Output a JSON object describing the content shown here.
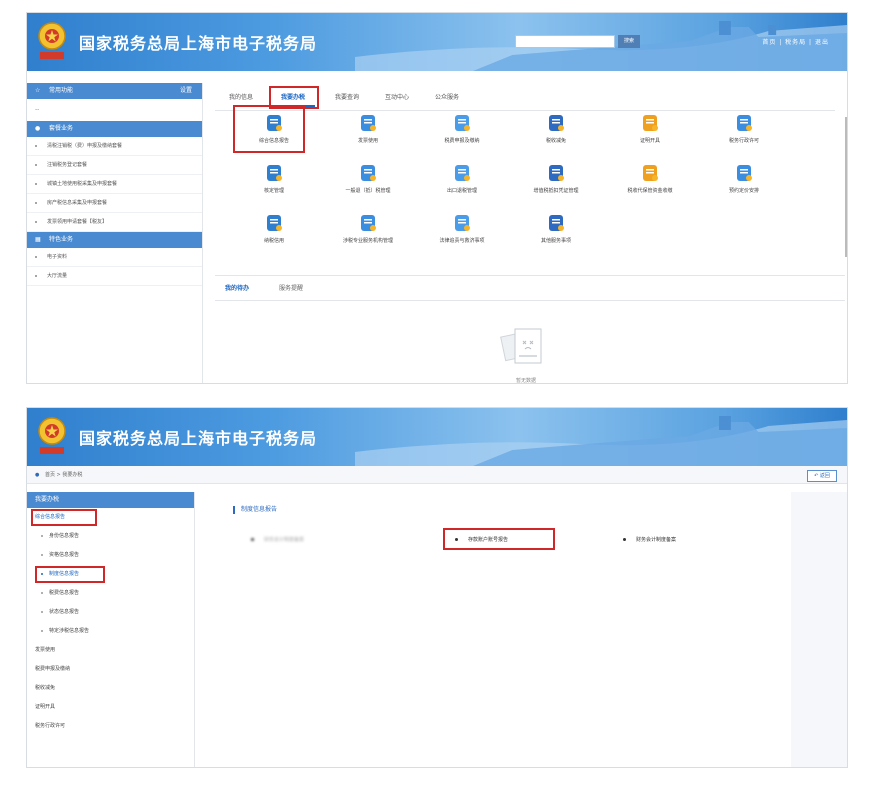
{
  "banner": {
    "title": "国家税务总局上海市电子税务局",
    "search_button": "搜索",
    "top_links": "首页 | 税务局 | 退出"
  },
  "panel1": {
    "sidebar": {
      "section1": {
        "label": "常用功能",
        "right": "设置"
      },
      "dash": "--",
      "section2": {
        "label": "套餐业务"
      },
      "items": [
        "清税注销税（费）申报及缴纳套餐",
        "注销税务登记套餐",
        "城镇土地使用税采集及申报套餐",
        "房产税信息采集及申报套餐",
        "发票领用申请套餐【税友】"
      ],
      "section3": {
        "label": "特色业务"
      },
      "items2": [
        "电子资料",
        "大厅流量"
      ]
    },
    "tabs": [
      "我的信息",
      "我要办税",
      "我要查询",
      "互动中心",
      "公众服务"
    ],
    "active_tab": 1,
    "services": [
      "综合信息报告",
      "发票使用",
      "税费申报及缴纳",
      "税收减免",
      "证明开具",
      "税务行政许可",
      "核定管理",
      "一般退（抵）税管理",
      "出口退税管理",
      "增值税抵扣凭证管理",
      "税收代保管资金收缴",
      "预约定价安排",
      "纳税信用",
      "涉税专业服务机构管理",
      "法律追责与救济事项",
      "其他服务事项"
    ],
    "todo_tabs": [
      "我的待办",
      "服务提醒"
    ],
    "empty_text": "暂无数据"
  },
  "panel2": {
    "banner_title": "国家税务总局上海市电子税务局",
    "breadcrumb": "首页 > 我要办税",
    "back_button": "返回",
    "sidebar": {
      "head": "我要办税",
      "selected_group": "综合信息报告",
      "sub_items": [
        "身份信息报告",
        "资格信息报告",
        "制度信息报告",
        "税费信息报告",
        "状态信息报告",
        "特定涉税信息报告"
      ],
      "selected_sub": 2,
      "groups": [
        "发票使用",
        "税费申报及缴纳",
        "税收减免",
        "证明开具",
        "税务行政许可"
      ]
    },
    "section_title": "制度信息报告",
    "options": [
      "财务会计制度备案",
      "存款账户账号报告",
      "财务会计制度备案"
    ]
  },
  "colors": {
    "banner_blue": "#2f7fce",
    "accent_blue": "#1b66c2",
    "sidebar_head": "#4a8ad1",
    "highlight_red": "#d02828"
  }
}
